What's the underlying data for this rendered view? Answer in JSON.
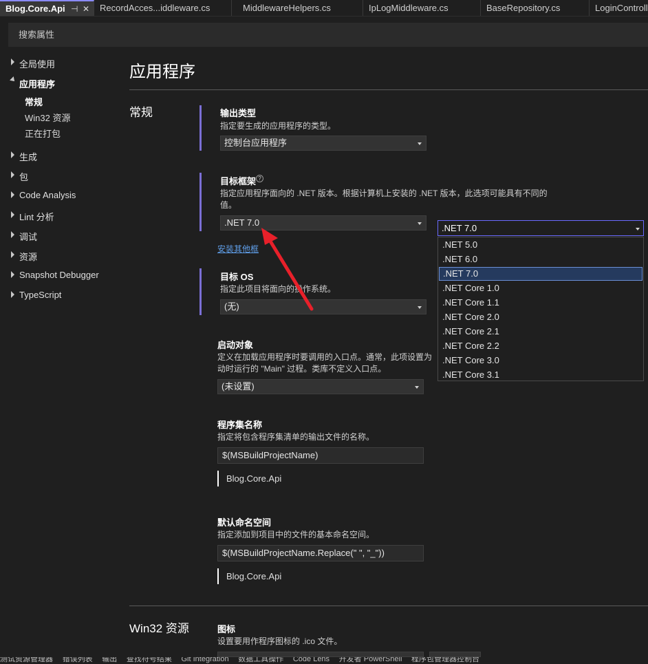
{
  "tabs": [
    {
      "label": "Blog.Core.Api",
      "active": true
    },
    {
      "label": "RecordAcces...iddleware.cs"
    },
    {
      "label": "MiddlewareHelpers.cs"
    },
    {
      "label": "IpLogMiddleware.cs"
    },
    {
      "label": "BaseRepository.cs"
    },
    {
      "label": "LoginControll"
    }
  ],
  "search": {
    "placeholder": "搜索属性"
  },
  "nav": {
    "items": [
      {
        "label": "全局使用",
        "expanded": false
      },
      {
        "label": "应用程序",
        "expanded": true,
        "children": [
          "常规",
          "Win32 资源",
          "正在打包"
        ]
      },
      {
        "label": "生成"
      },
      {
        "label": "包"
      },
      {
        "label": "Code Analysis"
      },
      {
        "label": "Lint 分析"
      },
      {
        "label": "调试"
      },
      {
        "label": "资源"
      },
      {
        "label": "Snapshot Debugger"
      },
      {
        "label": "TypeScript"
      }
    ]
  },
  "main": {
    "page_title": "应用程序",
    "section_general": "常规",
    "section_win32": "Win32 资源",
    "output_type": {
      "label": "输出类型",
      "desc": "指定要生成的应用程序的类型。",
      "value": "控制台应用程序"
    },
    "target_framework": {
      "label": "目标框架",
      "desc_line1": "指定应用程序面向的 .NET 版本。根据计算机上安装的 .NET 版本，此选项可能具有不同的",
      "desc_line2": "值。",
      "value": ".NET 7.0",
      "link": "安装其他框"
    },
    "target_os": {
      "label": "目标 OS",
      "desc": "指定此项目将面向的操作系统。",
      "value": "(无)"
    },
    "startup_object": {
      "label": "启动对象",
      "desc_line1": "定义在加载应用程序时要调用的入口点。通常，此项设置为",
      "desc_line2": "动时运行的 \"Main\" 过程。类库不定义入口点。",
      "value": "(未设置)"
    },
    "assembly_name": {
      "label": "程序集名称",
      "desc": "指定将包含程序集清单的输出文件的名称。",
      "value": "$(MSBuildProjectName)",
      "resolved": "Blog.Core.Api"
    },
    "default_namespace": {
      "label": "默认命名空间",
      "desc": "指定添加到项目中的文件的基本命名空间。",
      "value": "$(MSBuildProjectName.Replace(\" \", \"_\"))",
      "resolved": "Blog.Core.Api"
    },
    "icon": {
      "label": "图标",
      "desc": "设置要用作程序图标的 .ico 文件。"
    }
  },
  "dropdown": {
    "current": ".NET 7.0",
    "options": [
      ".NET 5.0",
      ".NET 6.0",
      ".NET 7.0",
      ".NET Core 1.0",
      ".NET Core 1.1",
      ".NET Core 2.0",
      ".NET Core 2.1",
      ".NET Core 2.2",
      ".NET Core 3.0",
      ".NET Core 3.1"
    ],
    "selected_index": 2
  },
  "statusbar": [
    "测试资源管理器",
    "错误列表",
    "输出",
    "查找符号结果",
    "Git Integration",
    "数据工具操作",
    "Code Lens",
    "开发者 PowerShell",
    "程序包管理器控制台"
  ],
  "colors": {
    "accent": "#7b6fd6",
    "link": "#5f9ee8",
    "annotation_arrow": "#e8202a"
  }
}
